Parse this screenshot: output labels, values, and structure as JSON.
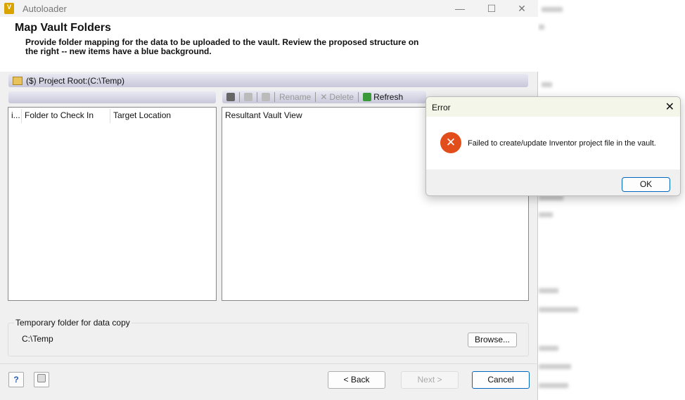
{
  "window": {
    "title": "Autoloader",
    "app_icon": "V",
    "minimize": "—",
    "maximize": "☐",
    "close": "✕"
  },
  "header": {
    "title": "Map Vault Folders",
    "description": "Provide folder mapping for the data to be uploaded to the vault. Review the proposed structure on the right -- new items have a blue background."
  },
  "root_bar": {
    "label": "($) Project Root:(C:\\Temp)"
  },
  "toolbar": {
    "rename": "Rename",
    "delete": "Delete",
    "refresh": "Refresh"
  },
  "left_panel": {
    "columns": [
      "i...",
      "Folder to Check In",
      "Target Location"
    ]
  },
  "right_panel": {
    "column": "Resultant Vault View"
  },
  "temp_group": {
    "label": "Temporary folder for data copy",
    "path": "C:\\Temp",
    "browse": "Browse..."
  },
  "footer": {
    "help": "?",
    "back": "< Back",
    "next": "Next >",
    "cancel": "Cancel"
  },
  "error_dialog": {
    "title": "Error",
    "message": "Failed to create/update Inventor project file in the vault.",
    "ok": "OK",
    "close": "✕",
    "icon": "✕"
  }
}
